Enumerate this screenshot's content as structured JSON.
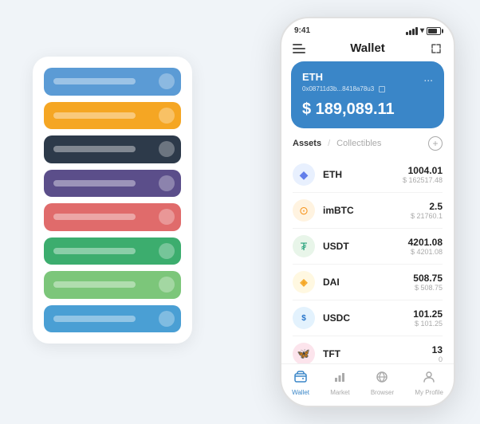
{
  "scene": {
    "background_color": "#f0f4f8"
  },
  "card_stack": {
    "bars": [
      {
        "color_class": "bar-blue",
        "label": "blue-bar"
      },
      {
        "color_class": "bar-orange",
        "label": "orange-bar"
      },
      {
        "color_class": "bar-dark",
        "label": "dark-bar"
      },
      {
        "color_class": "bar-purple",
        "label": "purple-bar"
      },
      {
        "color_class": "bar-red",
        "label": "red-bar"
      },
      {
        "color_class": "bar-green",
        "label": "green-bar"
      },
      {
        "color_class": "bar-lightgreen",
        "label": "lightgreen-bar"
      },
      {
        "color_class": "bar-lightblue",
        "label": "lightblue-bar"
      }
    ]
  },
  "phone": {
    "status_bar": {
      "time": "9:41"
    },
    "header": {
      "title": "Wallet",
      "menu_icon_label": "☰",
      "expand_icon_label": "⤢"
    },
    "eth_card": {
      "token": "ETH",
      "address": "0x08711d3b...8418a78u3",
      "amount": "$ 189,089.11",
      "currency_symbol": "$",
      "dots": "..."
    },
    "assets_section": {
      "tab_active": "Assets",
      "tab_divider": "/",
      "tab_inactive": "Collectibles",
      "add_label": "+"
    },
    "assets": [
      {
        "symbol": "ETH",
        "icon_emoji": "◆",
        "icon_class": "asset-icon-eth",
        "amount_primary": "1004.01",
        "amount_secondary": "$ 162517.48"
      },
      {
        "symbol": "imBTC",
        "icon_emoji": "⊙",
        "icon_class": "asset-icon-btc",
        "amount_primary": "2.5",
        "amount_secondary": "$ 21760.1"
      },
      {
        "symbol": "USDT",
        "icon_emoji": "₮",
        "icon_class": "asset-icon-usdt",
        "amount_primary": "4201.08",
        "amount_secondary": "$ 4201.08"
      },
      {
        "symbol": "DAI",
        "icon_emoji": "◈",
        "icon_class": "asset-icon-dai",
        "amount_primary": "508.75",
        "amount_secondary": "$ 508.75"
      },
      {
        "symbol": "USDC",
        "icon_emoji": "$",
        "icon_class": "asset-icon-usdc",
        "amount_primary": "101.25",
        "amount_secondary": "$ 101.25"
      },
      {
        "symbol": "TFT",
        "icon_emoji": "🦋",
        "icon_class": "asset-icon-tft",
        "amount_primary": "13",
        "amount_secondary": "0"
      }
    ],
    "bottom_nav": [
      {
        "label": "Wallet",
        "icon": "◎",
        "active": true
      },
      {
        "label": "Market",
        "icon": "📊",
        "active": false
      },
      {
        "label": "Browser",
        "icon": "👤",
        "active": false
      },
      {
        "label": "My Profile",
        "icon": "👤",
        "active": false
      }
    ]
  }
}
